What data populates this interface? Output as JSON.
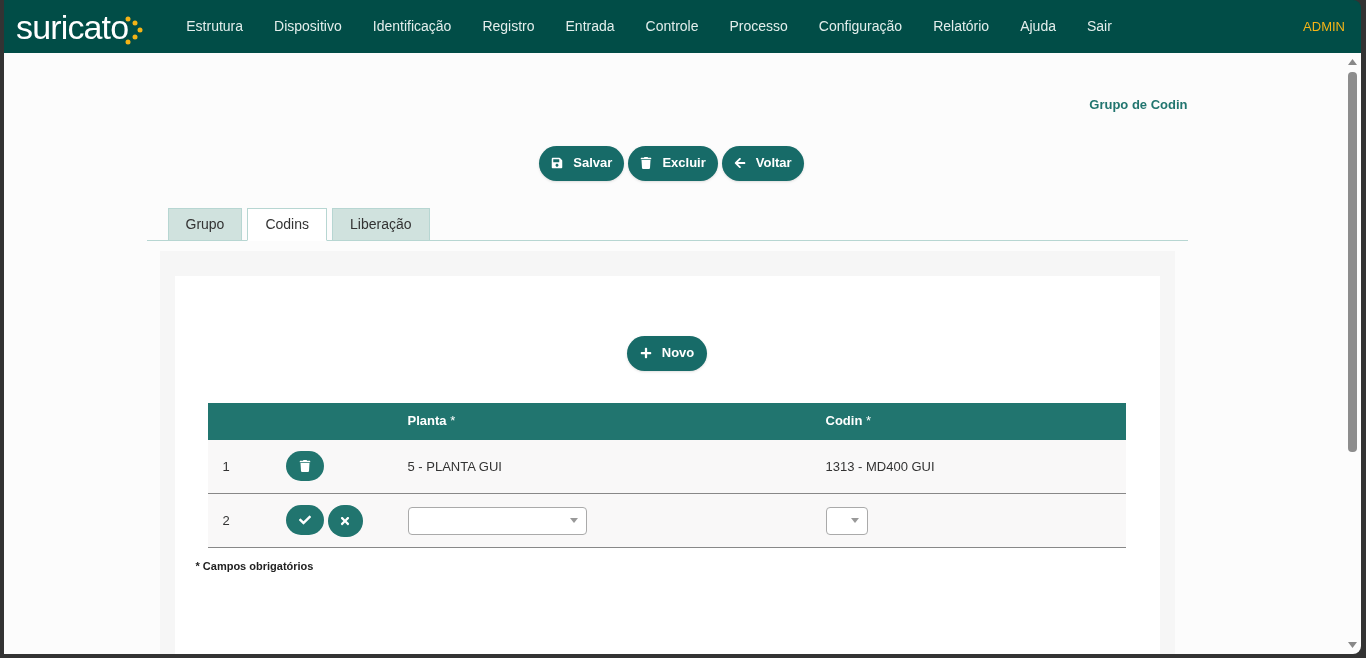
{
  "header": {
    "logo": "suricato",
    "nav": [
      "Estrutura",
      "Dispositivo",
      "Identificação",
      "Registro",
      "Entrada",
      "Controle",
      "Processo",
      "Configuração",
      "Relatório",
      "Ajuda",
      "Sair"
    ],
    "user": "ADMIN"
  },
  "page_title": "Grupo de Codin",
  "actions": [
    {
      "kind": "save",
      "label": "Salvar"
    },
    {
      "kind": "delete",
      "label": "Excluir"
    },
    {
      "kind": "back",
      "label": "Voltar"
    }
  ],
  "tabs": [
    {
      "label": "Grupo",
      "selected": false
    },
    {
      "label": "Codins",
      "selected": true
    },
    {
      "label": "Liberação",
      "selected": false
    }
  ],
  "new_button": "Novo",
  "table": {
    "columns": [
      "Planta *",
      "Codin *"
    ],
    "rows": [
      {
        "kind": "saved",
        "index": "1",
        "planta": "5 - PLANTA GUI",
        "codin": "1313 - MD400 GUI"
      },
      {
        "kind": "editing",
        "index": "2"
      }
    ]
  },
  "footnote": "* Campos obrigatórios"
}
